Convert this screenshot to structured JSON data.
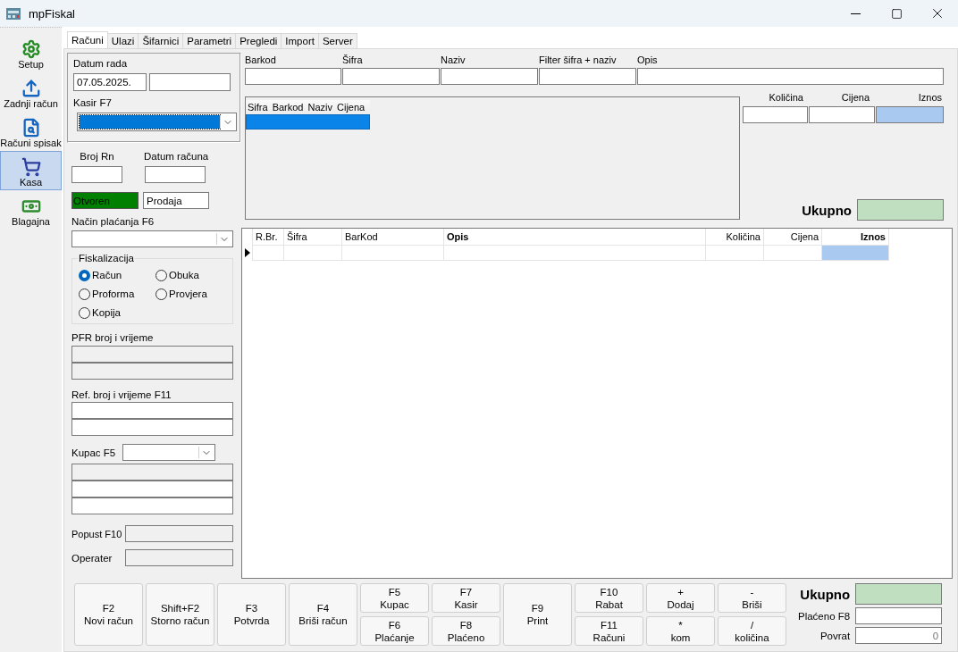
{
  "window": {
    "title": "mpFiskal"
  },
  "sidebar": {
    "items": [
      {
        "label": "Setup",
        "kind": "gear",
        "selected": false
      },
      {
        "label": "Zadnji račun",
        "kind": "upload",
        "selected": false
      },
      {
        "label": "Računi spisak",
        "kind": "document",
        "selected": false
      },
      {
        "label": "Kasa",
        "kind": "cart",
        "selected": true
      },
      {
        "label": "Blagajna",
        "kind": "money",
        "selected": false
      }
    ]
  },
  "tabs": [
    {
      "label": "Računi",
      "selected": true
    },
    {
      "label": "Ulazi",
      "selected": false
    },
    {
      "label": "Šifarnici",
      "selected": false
    },
    {
      "label": "Parametri",
      "selected": false
    },
    {
      "label": "Pregledi",
      "selected": false
    },
    {
      "label": "Import",
      "selected": false
    },
    {
      "label": "Server",
      "selected": false
    }
  ],
  "session": {
    "date_label": "Datum rada",
    "date_value": "07.05.2025.",
    "cashier_label": "Kasir F7",
    "cashier_focused": true
  },
  "invoice": {
    "number_label": "Broj Rn",
    "date_label": "Datum računa",
    "status": "Otvoren",
    "status_open": true,
    "type": "Prodaja",
    "payment_label": "Način plaćanja F6"
  },
  "fiscalization": {
    "title": "Fiskalizacija",
    "options": [
      {
        "label": "Račun",
        "selected": true
      },
      {
        "label": "Obuka",
        "selected": false
      },
      {
        "label": "Proforma",
        "selected": false
      },
      {
        "label": "Provjera",
        "selected": false
      },
      {
        "label": "Kopija",
        "selected": false
      }
    ]
  },
  "pfr_label": "PFR broj i vrijeme",
  "ref_label": "Ref. broj i vrijeme F11",
  "customer_label": "Kupac F5",
  "discount_label": "Popust F10",
  "operator_label": "Operater",
  "search": {
    "fields": [
      {
        "label": "Barkod"
      },
      {
        "label": "Šifra"
      },
      {
        "label": "Naziv"
      },
      {
        "label": "Filter šifra + naziv"
      },
      {
        "label": "Opis"
      }
    ]
  },
  "lookup": {
    "columns": [
      "Sifra",
      "Barkod",
      "Naziv",
      "Cijena"
    ],
    "rows": [
      {
        "selected": true
      }
    ]
  },
  "entry": {
    "labels": [
      "Količina",
      "Cijena",
      "Iznos"
    ],
    "total_label": "Ukupno"
  },
  "table": {
    "columns": [
      {
        "label": "R.Br.",
        "kind": "text",
        "bold": false
      },
      {
        "label": "Šifra",
        "kind": "text",
        "bold": false
      },
      {
        "label": "BarKod",
        "kind": "text",
        "bold": false
      },
      {
        "label": "Opis",
        "kind": "text",
        "bold": true
      },
      {
        "label": "Količina",
        "kind": "number",
        "bold": false
      },
      {
        "label": "Cijena",
        "kind": "number",
        "bold": false
      },
      {
        "label": "Iznos",
        "kind": "number",
        "bold": true
      }
    ],
    "rows": [
      {
        "current": true
      }
    ]
  },
  "function_buttons": [
    {
      "kind": "tall",
      "items": [
        {
          "key": "F2",
          "label": "Novi račun"
        }
      ]
    },
    {
      "kind": "tall",
      "items": [
        {
          "key": "Shift+F2",
          "label": "Storno račun"
        }
      ]
    },
    {
      "kind": "tall",
      "items": [
        {
          "key": "F3",
          "label": "Potvrda"
        }
      ]
    },
    {
      "kind": "tall",
      "items": [
        {
          "key": "F4",
          "label": "Briši račun"
        }
      ]
    },
    {
      "kind": "pair",
      "items": [
        {
          "key": "F5",
          "label": "Kupac"
        },
        {
          "key": "F6",
          "label": "Plaćanje"
        }
      ]
    },
    {
      "kind": "pair",
      "items": [
        {
          "key": "F7",
          "label": "Kasir"
        },
        {
          "key": "F8",
          "label": "Plaćeno"
        }
      ]
    },
    {
      "kind": "tall",
      "items": [
        {
          "key": "F9",
          "label": "Print"
        }
      ]
    },
    {
      "kind": "pair",
      "items": [
        {
          "key": "F10",
          "label": "Rabat"
        },
        {
          "key": "F11",
          "label": "Računi"
        }
      ]
    },
    {
      "kind": "pair",
      "items": [
        {
          "key": "+",
          "label": "Dodaj"
        },
        {
          "key": "*",
          "label": "kom"
        }
      ]
    },
    {
      "kind": "pair",
      "items": [
        {
          "key": "-",
          "label": "Briši"
        },
        {
          "key": "/",
          "label": "količina"
        }
      ]
    }
  ],
  "totals": {
    "total_label": "Ukupno",
    "paid_label": "Plaćeno F8",
    "change_label": "Povrat",
    "change_value": "0"
  }
}
